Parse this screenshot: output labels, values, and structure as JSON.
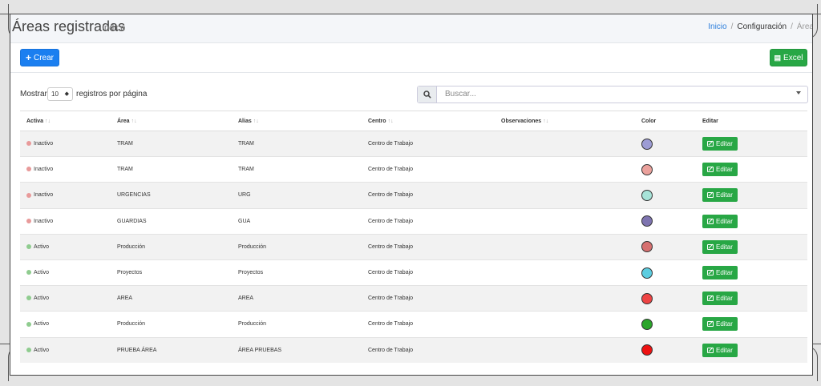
{
  "header": {
    "title": "Áreas registradas",
    "subtitle": "Indice",
    "breadcrumb": {
      "home": "Inicio",
      "config": "Configuración",
      "current": "Área"
    }
  },
  "toolbar": {
    "create_label": "Crear",
    "excel_label": "Excel"
  },
  "controls": {
    "show_label": "Mostrar",
    "per_page_value": "10",
    "per_page_suffix": "registros por página",
    "search_placeholder": "Buscar..."
  },
  "table": {
    "headers": {
      "active": "Activa",
      "area": "Área",
      "alias": "Alias",
      "center": "Centro",
      "observations": "Observaciones",
      "color": "Color",
      "edit": "Editar"
    },
    "sort_glyph": "↑↓",
    "edit_label": "Editar",
    "rows": [
      {
        "status": "Inactivo",
        "status_color": "#e89a9a",
        "area": "TRAM",
        "alias": "TRAM",
        "center": "Centro de Trabajo",
        "observations": "",
        "color": "#9d9cd4"
      },
      {
        "status": "Inactivo",
        "status_color": "#e89a9a",
        "area": "TRAM",
        "alias": "TRAM",
        "center": "Centro de Trabajo",
        "observations": "",
        "color": "#eba19c"
      },
      {
        "status": "Inactivo",
        "status_color": "#e89a9a",
        "area": "URGENCIAS",
        "alias": "URG",
        "center": "Centro de Trabajo",
        "observations": "",
        "color": "#a7e3d8"
      },
      {
        "status": "Inactivo",
        "status_color": "#e89a9a",
        "area": "GUARDIAS",
        "alias": "GUA",
        "center": "Centro de Trabajo",
        "observations": "",
        "color": "#7e74b0"
      },
      {
        "status": "Activo",
        "status_color": "#8fcc8f",
        "area": "Producción",
        "alias": "Producción",
        "center": "Centro de Trabajo",
        "observations": "",
        "color": "#d67070"
      },
      {
        "status": "Activo",
        "status_color": "#8fcc8f",
        "area": "Proyectos",
        "alias": "Proyectos",
        "center": "Centro de Trabajo",
        "observations": "",
        "color": "#5ccde0"
      },
      {
        "status": "Activo",
        "status_color": "#8fcc8f",
        "area": "AREA",
        "alias": "AREA",
        "center": "Centro de Trabajo",
        "observations": "",
        "color": "#ee4444"
      },
      {
        "status": "Activo",
        "status_color": "#8fcc8f",
        "area": "Producción",
        "alias": "Producción",
        "center": "Centro de Trabajo",
        "observations": "",
        "color": "#2aa52a"
      },
      {
        "status": "Activo",
        "status_color": "#8fcc8f",
        "area": "PRUEBA ÁREA",
        "alias": "ÁREA PRUEBAS",
        "center": "Centro de Trabajo",
        "observations": "",
        "color": "#ee1111"
      }
    ]
  }
}
